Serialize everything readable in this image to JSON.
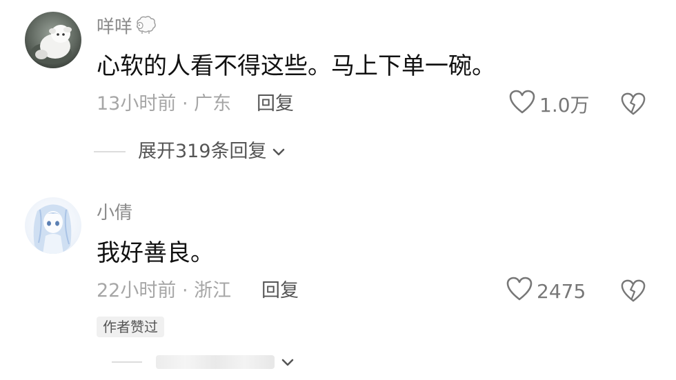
{
  "comments": [
    {
      "username": "咩咩",
      "username_emoji": "sheep-icon",
      "text": "心软的人看不得这些。马上下单一碗。",
      "time_location": "13小时前 · 广东",
      "reply_label": "回复",
      "likes": "1.0万",
      "expand_label": "展开319条回复"
    },
    {
      "username": "小倩",
      "text": "我好善良。",
      "time_location": "22小时前 · 浙江",
      "reply_label": "回复",
      "likes": "2475",
      "badge": "作者赞过"
    }
  ],
  "icons": {
    "like": "heart-outline-icon",
    "dislike": "broken-heart-icon",
    "expand": "chevron-down-icon"
  },
  "colors": {
    "text_primary": "#111111",
    "text_secondary": "#8a8a8a",
    "text_meta": "#a6a6a6",
    "icon": "#777777",
    "badge_bg": "#f0f0f0"
  }
}
